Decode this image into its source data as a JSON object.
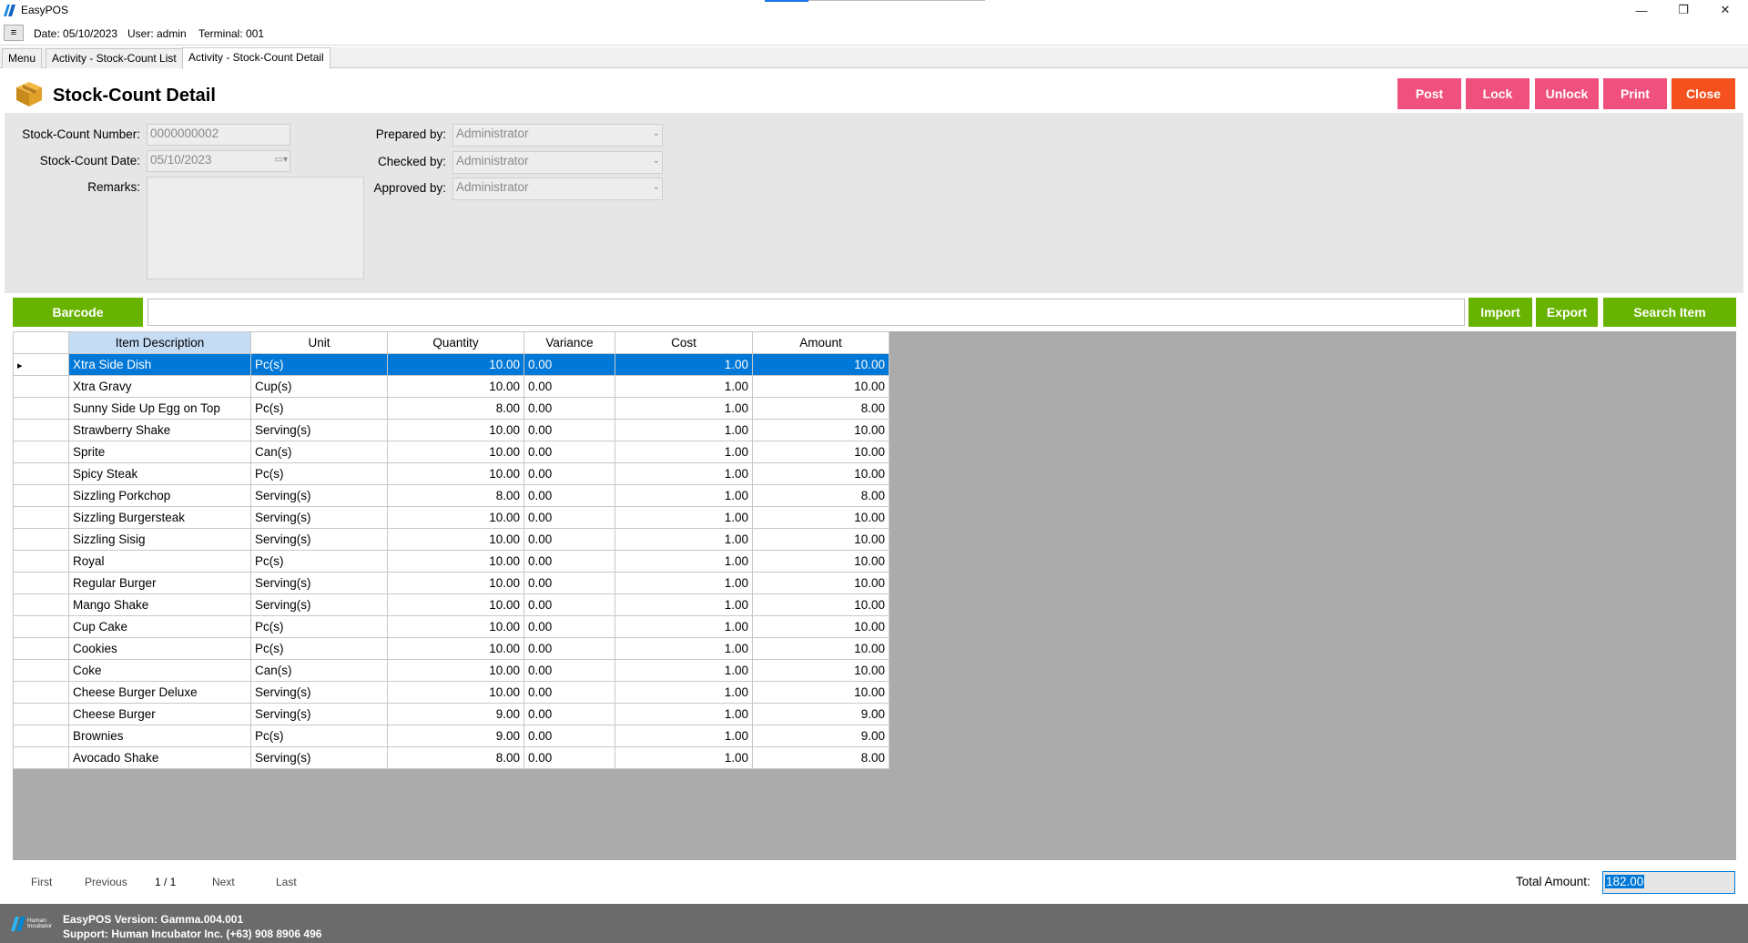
{
  "window": {
    "title": "EasyPOS",
    "minimize": "—",
    "restore": "❐",
    "close": "✕"
  },
  "infobar": {
    "menu_button": "≡",
    "date": "Date: 05/10/2023",
    "user": "User: admin",
    "terminal": "Terminal: 001"
  },
  "tabs": [
    {
      "label": "Menu"
    },
    {
      "label": "Activity - Stock-Count List"
    },
    {
      "label": "Activity - Stock-Count Detail"
    }
  ],
  "header": {
    "title": "Stock-Count Detail",
    "buttons": {
      "post": "Post",
      "lock": "Lock",
      "unlock": "Unlock",
      "print": "Print",
      "close": "Close"
    },
    "colors": {
      "pink": "#f0507d",
      "orange": "#f4511e"
    }
  },
  "form": {
    "number_label": "Stock-Count Number:",
    "number_value": "0000000002",
    "date_label": "Stock-Count Date:",
    "date_value": "05/10/2023",
    "remarks_label": "Remarks:",
    "remarks_value": "",
    "prepared_label": "Prepared by:",
    "prepared_value": "Administrator",
    "checked_label": "Checked by:",
    "checked_value": "Administrator",
    "approved_label": "Approved by:",
    "approved_value": "Administrator"
  },
  "toolbar": {
    "barcode": "Barcode",
    "barcode_value": "",
    "import": "Import",
    "export": "Export",
    "search_item": "Search Item",
    "accent": "#68b300"
  },
  "grid": {
    "columns": [
      "Item Description",
      "Unit",
      "Quantity",
      "Variance",
      "Cost",
      "Amount"
    ],
    "rows": [
      [
        "Xtra Side Dish",
        "Pc(s)",
        "10.00",
        "0.00",
        "1.00",
        "10.00"
      ],
      [
        "Xtra Gravy",
        "Cup(s)",
        "10.00",
        "0.00",
        "1.00",
        "10.00"
      ],
      [
        "Sunny Side Up Egg on Top",
        "Pc(s)",
        "8.00",
        "0.00",
        "1.00",
        "8.00"
      ],
      [
        "Strawberry Shake",
        "Serving(s)",
        "10.00",
        "0.00",
        "1.00",
        "10.00"
      ],
      [
        "Sprite",
        "Can(s)",
        "10.00",
        "0.00",
        "1.00",
        "10.00"
      ],
      [
        "Spicy Steak",
        "Pc(s)",
        "10.00",
        "0.00",
        "1.00",
        "10.00"
      ],
      [
        "Sizzling Porkchop",
        "Serving(s)",
        "8.00",
        "0.00",
        "1.00",
        "8.00"
      ],
      [
        "Sizzling Burgersteak",
        "Serving(s)",
        "10.00",
        "0.00",
        "1.00",
        "10.00"
      ],
      [
        "Sizzling  Sisig",
        "Serving(s)",
        "10.00",
        "0.00",
        "1.00",
        "10.00"
      ],
      [
        "Royal",
        "Pc(s)",
        "10.00",
        "0.00",
        "1.00",
        "10.00"
      ],
      [
        "Regular Burger",
        "Serving(s)",
        "10.00",
        "0.00",
        "1.00",
        "10.00"
      ],
      [
        "Mango Shake",
        "Serving(s)",
        "10.00",
        "0.00",
        "1.00",
        "10.00"
      ],
      [
        "Cup Cake",
        "Pc(s)",
        "10.00",
        "0.00",
        "1.00",
        "10.00"
      ],
      [
        "Cookies",
        "Pc(s)",
        "10.00",
        "0.00",
        "1.00",
        "10.00"
      ],
      [
        "Coke",
        "Can(s)",
        "10.00",
        "0.00",
        "1.00",
        "10.00"
      ],
      [
        "Cheese Burger Deluxe",
        "Serving(s)",
        "10.00",
        "0.00",
        "1.00",
        "10.00"
      ],
      [
        "Cheese Burger",
        "Serving(s)",
        "9.00",
        "0.00",
        "1.00",
        "9.00"
      ],
      [
        "Brownies",
        "Pc(s)",
        "9.00",
        "0.00",
        "1.00",
        "9.00"
      ],
      [
        "Avocado Shake",
        "Serving(s)",
        "8.00",
        "0.00",
        "1.00",
        "8.00"
      ]
    ],
    "selected_row": 0
  },
  "pager": {
    "first": "First",
    "previous": "Previous",
    "page": "1 / 1",
    "next": "Next",
    "last": "Last"
  },
  "total": {
    "label": "Total Amount:",
    "value": "182.00"
  },
  "footer": {
    "version": "EasyPOS Version: Gamma.004.001",
    "support": "Support: Human Incubator Inc. (+63) 908 8906 496",
    "logo_text": "Human Incubator"
  }
}
